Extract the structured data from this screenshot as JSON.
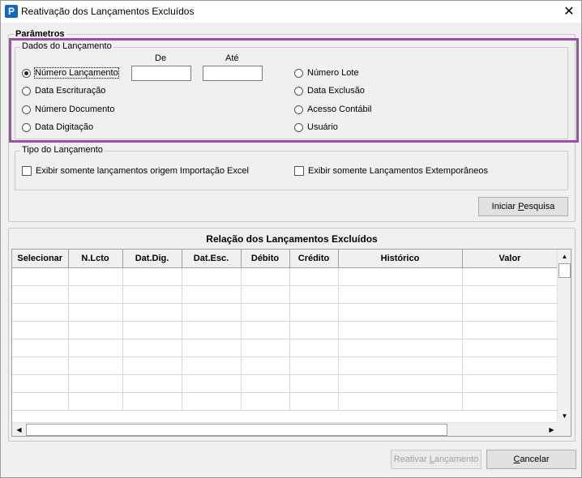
{
  "window": {
    "title": "Reativação dos Lançamentos Excluídos",
    "close_glyph": "✕",
    "app_icon_letter": "P"
  },
  "parametros": {
    "title": "Parâmetros",
    "dados": {
      "title": "Dados do Lançamento",
      "de_label": "De",
      "ate_label": "Até",
      "de_value": "",
      "ate_value": "",
      "radios_left": [
        {
          "label": "Número Lançamento",
          "checked": true
        },
        {
          "label": "Data Escrituração",
          "checked": false
        },
        {
          "label": "Número Documento",
          "checked": false
        },
        {
          "label": "Data Digitação",
          "checked": false
        }
      ],
      "radios_right": [
        {
          "label": "Número Lote",
          "checked": false
        },
        {
          "label": "Data Exclusão",
          "checked": false
        },
        {
          "label": "Acesso Contábil",
          "checked": false
        },
        {
          "label": "Usuário",
          "checked": false
        }
      ]
    },
    "tipo": {
      "title": "Tipo do Lançamento",
      "checkbox_excel": "Exibir somente lançamentos origem Importação Excel",
      "checkbox_extemp": "Exibir somente Lançamentos Extemporâneos"
    },
    "iniciar_pre": "Iniciar ",
    "iniciar_u": "P",
    "iniciar_post": "esquisa"
  },
  "grid": {
    "title": "Relação dos Lançamentos Excluídos",
    "columns": [
      "Selecionar",
      "N.Lcto",
      "Dat.Dig.",
      "Dat.Esc.",
      "Débito",
      "Crédito",
      "Histórico",
      "Valor"
    ],
    "rows": 8
  },
  "footer": {
    "reativar_pre": "Reativar ",
    "reativar_u": "L",
    "reativar_post": "ançamento",
    "cancelar_u": "C",
    "cancelar_post": "ancelar"
  },
  "colors": {
    "highlight": "#9b4fa6",
    "window_bg": "#f0f0f0",
    "icon_bg": "#1565c0"
  }
}
